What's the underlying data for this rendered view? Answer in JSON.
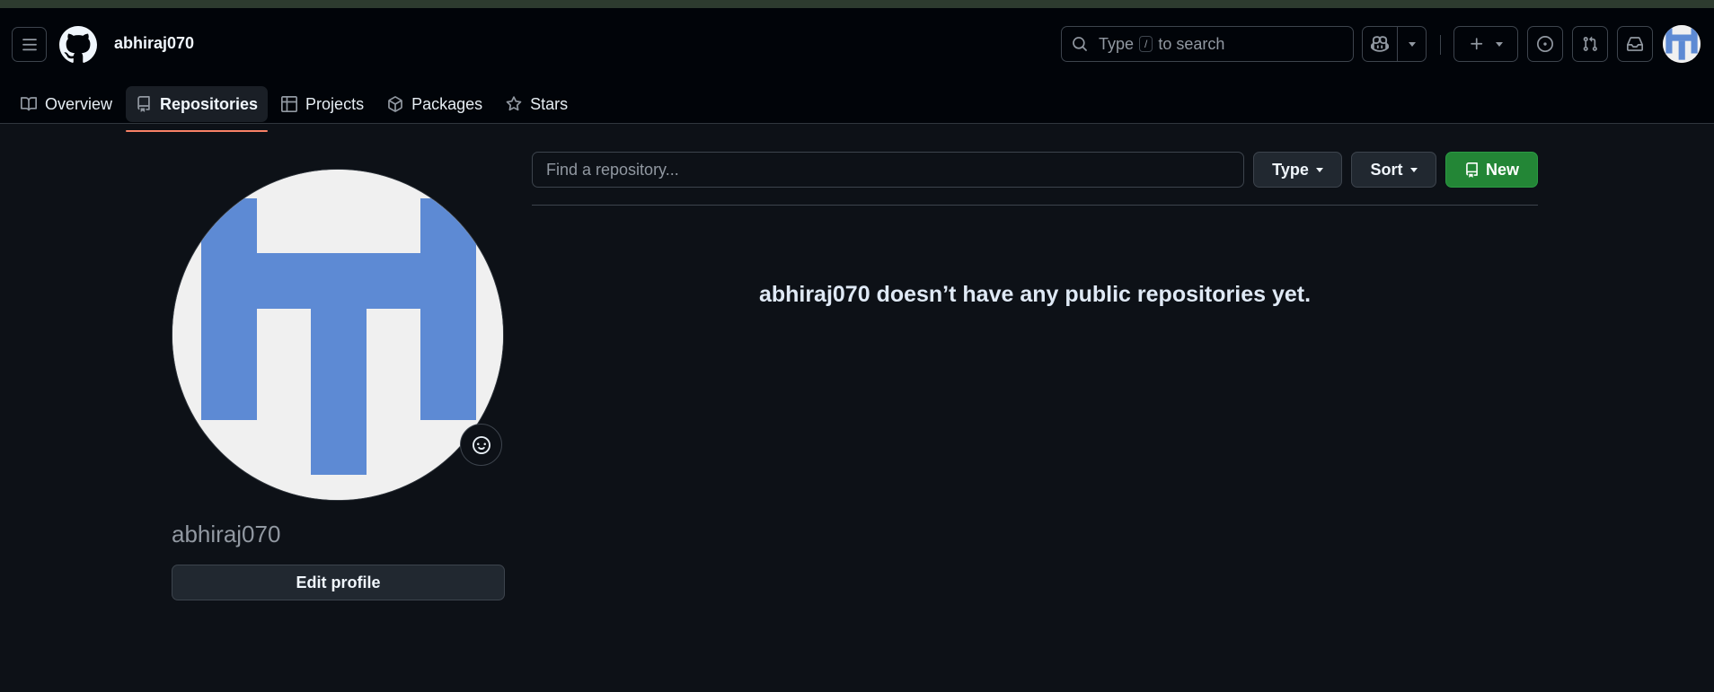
{
  "header": {
    "username": "abhiraj070",
    "search": {
      "prefix": "Type",
      "key": "/",
      "suffix": "to search"
    },
    "icons": {
      "menu": "hamburger-icon",
      "logo": "github-logo-icon",
      "search": "search-icon",
      "copilot": "copilot-icon",
      "create": "plus-icon",
      "issues": "issue-opened-icon",
      "pulls": "git-pull-request-icon",
      "inbox": "inbox-icon"
    }
  },
  "tabs": [
    {
      "label": "Overview",
      "icon": "book-icon",
      "active": false
    },
    {
      "label": "Repositories",
      "icon": "repo-icon",
      "active": true
    },
    {
      "label": "Projects",
      "icon": "table-icon",
      "active": false
    },
    {
      "label": "Packages",
      "icon": "package-icon",
      "active": false
    },
    {
      "label": "Stars",
      "icon": "star-icon",
      "active": false
    }
  ],
  "profile": {
    "login": "abhiraj070",
    "edit_label": "Edit profile",
    "avatar_colors": {
      "background": "#f0f0f0",
      "glyph": "#5d8ad4"
    }
  },
  "repos": {
    "find_placeholder": "Find a repository...",
    "type_label": "Type",
    "sort_label": "Sort",
    "new_label": "New",
    "empty_message": "abhiraj070 doesn’t have any public repositories yet."
  },
  "colors": {
    "page_bg": "#0d1117",
    "header_bg": "#010409",
    "accent_underline": "#f78166",
    "new_button": "#238636"
  }
}
